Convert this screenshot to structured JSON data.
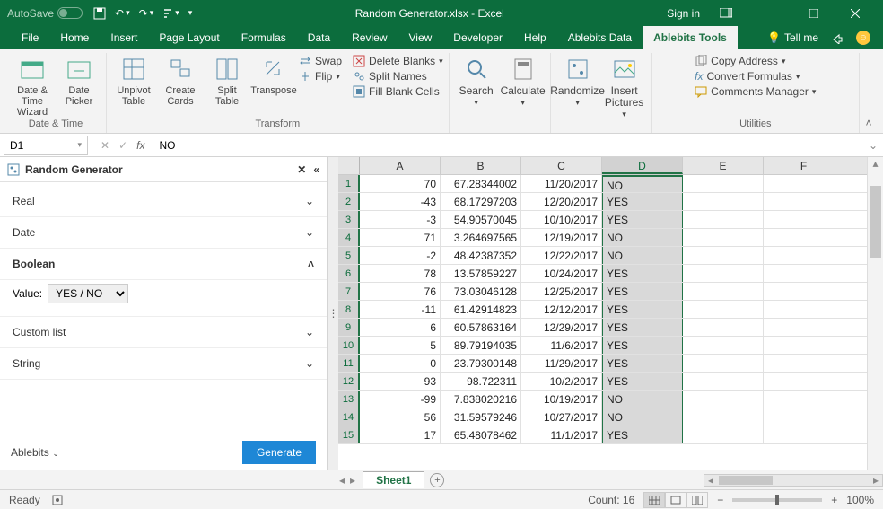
{
  "titlebar": {
    "autosave": "AutoSave",
    "filename": "Random Generator.xlsx  -  Excel",
    "signin": "Sign in"
  },
  "tabs": {
    "items": [
      "File",
      "Home",
      "Insert",
      "Page Layout",
      "Formulas",
      "Data",
      "Review",
      "View",
      "Developer",
      "Help",
      "Ablebits Data",
      "Ablebits Tools"
    ],
    "active": "Ablebits Tools",
    "tellme": "Tell me"
  },
  "ribbon": {
    "date_time": {
      "wizard": "Date & Time Wizard",
      "picker": "Date Picker",
      "label": "Date & Time"
    },
    "transform": {
      "unpivot": "Unpivot Table",
      "create": "Create Cards",
      "split": "Split Table",
      "transpose": "Transpose",
      "swap": "Swap",
      "flip": "Flip",
      "delete": "Delete Blanks",
      "splitnames": "Split Names",
      "fill": "Fill Blank Cells",
      "label": "Transform"
    },
    "mid": {
      "search": "Search",
      "calc": "Calculate",
      "random": "Randomize",
      "insert": "Insert Pictures"
    },
    "utils": {
      "copy": "Copy Address",
      "convert": "Convert Formulas",
      "comments": "Comments Manager",
      "label": "Utilities"
    }
  },
  "formula": {
    "cell": "D1",
    "value": "NO"
  },
  "panel": {
    "title": "Random Generator",
    "sections": [
      "Real",
      "Date",
      "Boolean",
      "Custom list",
      "String"
    ],
    "expanded": "Boolean",
    "value_label": "Value:",
    "value_sel": "YES / NO",
    "brand": "Ablebits",
    "generate": "Generate"
  },
  "grid": {
    "cols": [
      "A",
      "B",
      "C",
      "D",
      "E",
      "F"
    ],
    "selcol": "D",
    "rows": [
      {
        "n": 1,
        "A": "70",
        "B": "67.28344002",
        "C": "11/20/2017",
        "D": "NO"
      },
      {
        "n": 2,
        "A": "-43",
        "B": "68.17297203",
        "C": "12/20/2017",
        "D": "YES"
      },
      {
        "n": 3,
        "A": "-3",
        "B": "54.90570045",
        "C": "10/10/2017",
        "D": "YES"
      },
      {
        "n": 4,
        "A": "71",
        "B": "3.264697565",
        "C": "12/19/2017",
        "D": "NO"
      },
      {
        "n": 5,
        "A": "-2",
        "B": "48.42387352",
        "C": "12/22/2017",
        "D": "NO"
      },
      {
        "n": 6,
        "A": "78",
        "B": "13.57859227",
        "C": "10/24/2017",
        "D": "YES"
      },
      {
        "n": 7,
        "A": "76",
        "B": "73.03046128",
        "C": "12/25/2017",
        "D": "YES"
      },
      {
        "n": 8,
        "A": "-11",
        "B": "61.42914823",
        "C": "12/12/2017",
        "D": "YES"
      },
      {
        "n": 9,
        "A": "6",
        "B": "60.57863164",
        "C": "12/29/2017",
        "D": "YES"
      },
      {
        "n": 10,
        "A": "5",
        "B": "89.79194035",
        "C": "11/6/2017",
        "D": "YES"
      },
      {
        "n": 11,
        "A": "0",
        "B": "23.79300148",
        "C": "11/29/2017",
        "D": "YES"
      },
      {
        "n": 12,
        "A": "93",
        "B": "98.722311",
        "C": "10/2/2017",
        "D": "YES"
      },
      {
        "n": 13,
        "A": "-99",
        "B": "7.838020216",
        "C": "10/19/2017",
        "D": "NO"
      },
      {
        "n": 14,
        "A": "56",
        "B": "31.59579246",
        "C": "10/27/2017",
        "D": "NO"
      },
      {
        "n": 15,
        "A": "17",
        "B": "65.48078462",
        "C": "11/1/2017",
        "D": "YES"
      }
    ]
  },
  "sheets": {
    "active": "Sheet1"
  },
  "status": {
    "ready": "Ready",
    "count": "Count: 16",
    "zoom": "100%"
  }
}
